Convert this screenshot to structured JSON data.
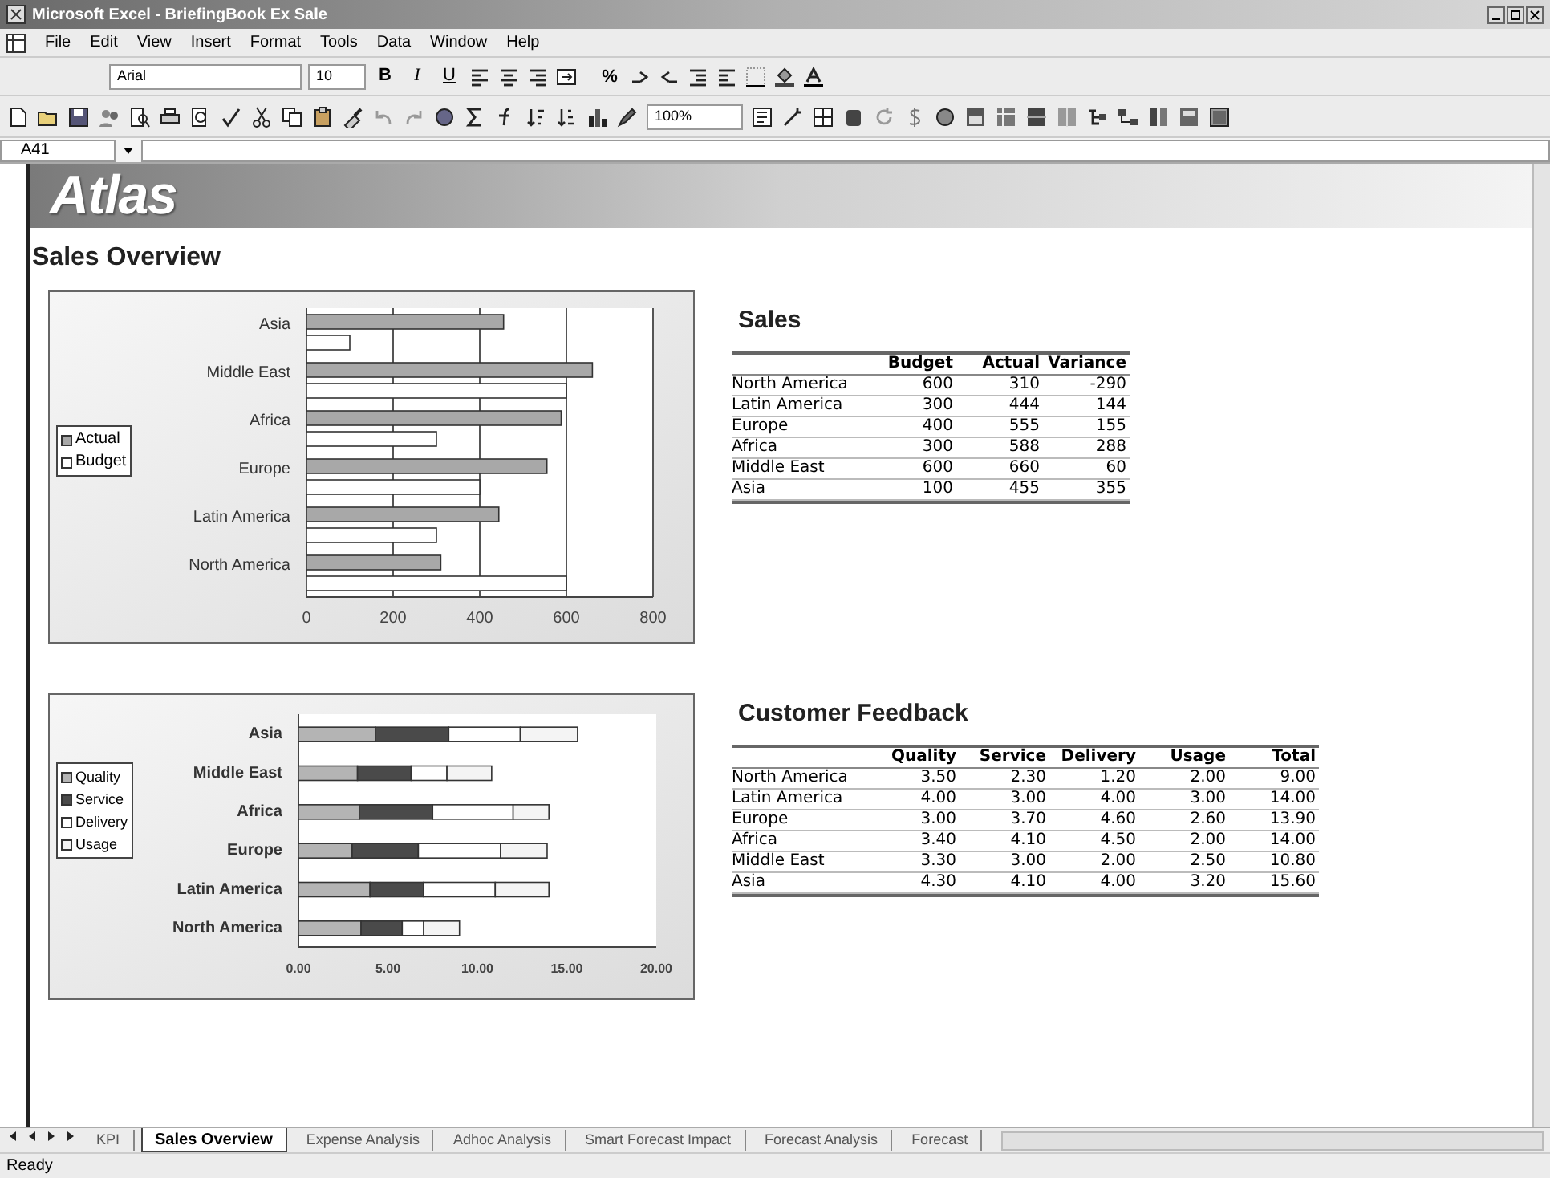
{
  "window": {
    "title": "Microsoft Excel - BriefingBook Ex Sale"
  },
  "menu": [
    "File",
    "Edit",
    "View",
    "Insert",
    "Format",
    "Tools",
    "Data",
    "Window",
    "Help"
  ],
  "format_toolbar": {
    "font": "Arial",
    "size": "10",
    "style_buttons": [
      "B",
      "I",
      "U"
    ],
    "percent": "%"
  },
  "standard_toolbar": {
    "zoom": "100%"
  },
  "formula_bar": {
    "name_box": "A41"
  },
  "sheet": {
    "logo": "Atlas",
    "title": "Sales Overview",
    "sales_chart": {
      "chart_data": {
        "type": "bar",
        "orientation": "horizontal",
        "categories": [
          "Asia",
          "Middle East",
          "Africa",
          "Europe",
          "Latin America",
          "North America"
        ],
        "series": [
          {
            "name": "Actual",
            "color": "#a8a8a8",
            "values": [
              455,
              660,
              588,
              555,
              444,
              310
            ]
          },
          {
            "name": "Budget",
            "color": "#ffffff",
            "values": [
              100,
              600,
              300,
              400,
              300,
              600
            ]
          }
        ],
        "xlim": [
          0,
          800
        ],
        "xticks": [
          0,
          200,
          400,
          600,
          800
        ],
        "grid": true,
        "legend": "left"
      }
    },
    "sales_table": {
      "title": "Sales",
      "columns": [
        "Budget",
        "Actual",
        "Variance"
      ],
      "rows": [
        {
          "region": "North America",
          "cells": [
            "600",
            "310",
            "-290"
          ]
        },
        {
          "region": "Latin America",
          "cells": [
            "300",
            "444",
            "144"
          ]
        },
        {
          "region": "Europe",
          "cells": [
            "400",
            "555",
            "155"
          ]
        },
        {
          "region": "Africa",
          "cells": [
            "300",
            "588",
            "288"
          ]
        },
        {
          "region": "Middle East",
          "cells": [
            "600",
            "660",
            "60"
          ]
        },
        {
          "region": "Asia",
          "cells": [
            "100",
            "455",
            "355"
          ]
        }
      ]
    },
    "feedback_chart": {
      "chart_data": {
        "type": "bar",
        "orientation": "horizontal",
        "stacked": true,
        "categories": [
          "Asia",
          "Middle East",
          "Africa",
          "Europe",
          "Latin America",
          "North America"
        ],
        "series": [
          {
            "name": "Quality",
            "color": "#b4b4b4",
            "values": [
              4.3,
              3.3,
              3.4,
              3.0,
              4.0,
              3.5
            ]
          },
          {
            "name": "Service",
            "color": "#4a4a4a",
            "values": [
              4.1,
              3.0,
              4.1,
              3.7,
              3.0,
              2.3
            ]
          },
          {
            "name": "Delivery",
            "color": "#ffffff",
            "values": [
              4.0,
              2.0,
              4.5,
              4.6,
              4.0,
              1.2
            ]
          },
          {
            "name": "Usage",
            "color": "#f4f4f4",
            "values": [
              3.2,
              2.5,
              2.0,
              2.6,
              3.0,
              2.0
            ]
          }
        ],
        "xlim": [
          0,
          20
        ],
        "xticks": [
          {
            "value": 0,
            "label": "0.00"
          },
          {
            "value": 5,
            "label": "5.00"
          },
          {
            "value": 10,
            "label": "10.00"
          },
          {
            "value": 15,
            "label": "15.00"
          },
          {
            "value": 20,
            "label": "20.00"
          }
        ],
        "legend": "left"
      }
    },
    "feedback_table": {
      "title": "Customer Feedback",
      "columns": [
        "Quality",
        "Service",
        "Delivery",
        "Usage",
        "Total"
      ],
      "rows": [
        {
          "region": "North America",
          "cells": [
            "3.50",
            "2.30",
            "1.20",
            "2.00",
            "9.00"
          ]
        },
        {
          "region": "Latin America",
          "cells": [
            "4.00",
            "3.00",
            "4.00",
            "3.00",
            "14.00"
          ]
        },
        {
          "region": "Europe",
          "cells": [
            "3.00",
            "3.70",
            "4.60",
            "2.60",
            "13.90"
          ]
        },
        {
          "region": "Africa",
          "cells": [
            "3.40",
            "4.10",
            "4.50",
            "2.00",
            "14.00"
          ]
        },
        {
          "region": "Middle East",
          "cells": [
            "3.30",
            "3.00",
            "2.00",
            "2.50",
            "10.80"
          ]
        },
        {
          "region": "Asia",
          "cells": [
            "4.30",
            "4.10",
            "4.00",
            "3.20",
            "15.60"
          ]
        }
      ]
    }
  },
  "sheet_tabs": [
    {
      "label": "KPI",
      "selected": false
    },
    {
      "label": "Sales Overview",
      "selected": true
    },
    {
      "label": "Expense Analysis",
      "selected": false
    },
    {
      "label": "Adhoc Analysis",
      "selected": false
    },
    {
      "label": "Smart Forecast Impact",
      "selected": false
    },
    {
      "label": "Forecast Analysis",
      "selected": false
    },
    {
      "label": "Forecast",
      "selected": false
    }
  ],
  "status_bar": {
    "text": "Ready"
  }
}
